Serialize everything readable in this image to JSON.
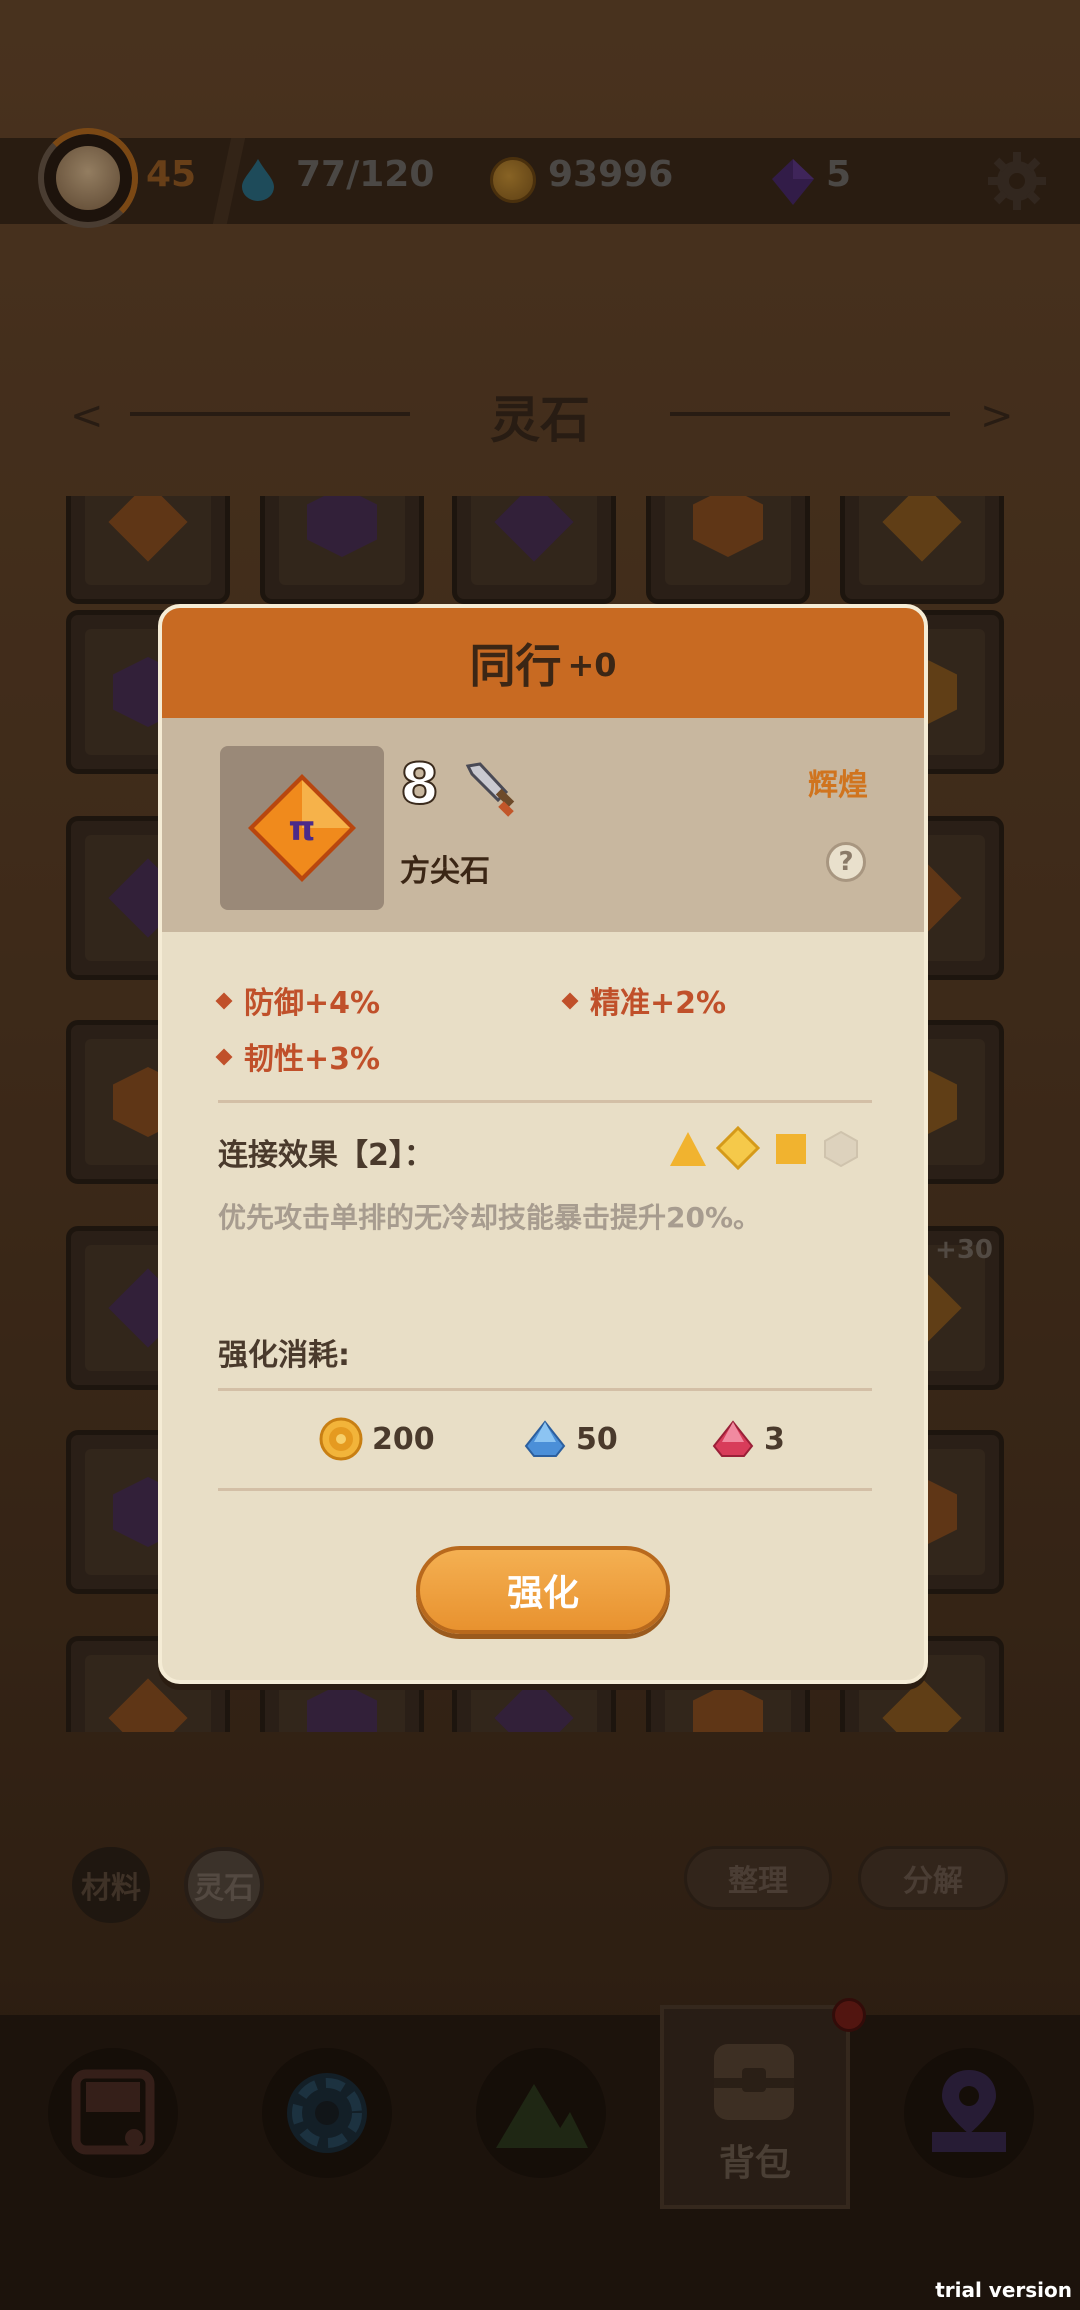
{
  "topbar": {
    "level": "45",
    "energy": "77/120",
    "coins": "93996",
    "gems": "5"
  },
  "screen_title": "灵石",
  "grid": {
    "badge": "+30"
  },
  "tabs": {
    "materials": "材料",
    "spirit_stones": "灵石"
  },
  "actions": {
    "sort": "整理",
    "decompose": "分解"
  },
  "nav": {
    "backpack": "背包"
  },
  "watermark": "trial version",
  "modal": {
    "title": "同行",
    "title_level": "+0",
    "count": "8",
    "stone_name": "方尖石",
    "rarity": "辉煌",
    "help": "?",
    "stone_glyph": "π",
    "stats": [
      "防御+4%",
      "精准+2%",
      "韧性+3%"
    ],
    "link_label": "连接效果【2】：",
    "link_desc": "优先攻击单排的无冷却技能暴击提升20%。",
    "cost_label": "强化消耗:",
    "costs": [
      {
        "icon": "coin-icon",
        "amount": "200"
      },
      {
        "icon": "blue-crystal-icon",
        "amount": "50"
      },
      {
        "icon": "red-crystal-icon",
        "amount": "3"
      }
    ],
    "enhance_button": "强化"
  },
  "colors": {
    "header": "#c86a22",
    "accent": "#e8922f",
    "stat": "#c0502a"
  }
}
